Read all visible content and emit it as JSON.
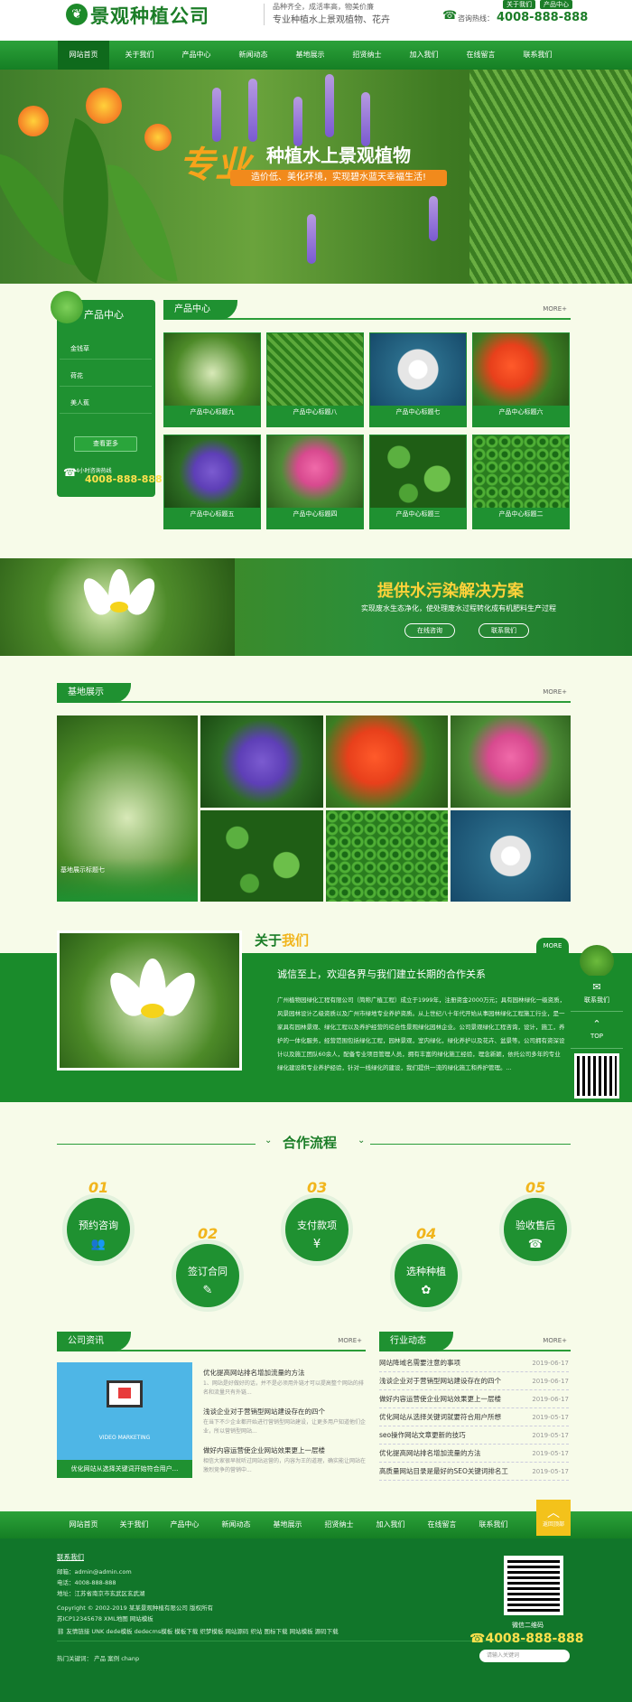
{
  "header": {
    "logo_text": "景观种植公司",
    "slogan_line1": "品种齐全，成活率高，物美价廉",
    "slogan_line2": "专业种植水上景观植物、花卉",
    "top_links": [
      "关于我们",
      "产品中心"
    ],
    "hotline_label": "咨询热线：",
    "hotline": "4008-888-888"
  },
  "nav": {
    "items": [
      "网站首页",
      "关于我们",
      "产品中心",
      "新闻动态",
      "基地展示",
      "招贤纳士",
      "加入我们",
      "在线留言",
      "联系我们"
    ],
    "active_index": 0
  },
  "banner": {
    "title_big": "专业",
    "title_rest": "种植水上景观植物",
    "subtitle": "造价低、美化环境，实现碧水蓝天幸福生活!"
  },
  "products": {
    "sidebar_title": "产品中心",
    "sidebar_items": [
      "金钱草",
      "荷花",
      "美人蕉"
    ],
    "more_button": "查看更多",
    "hotline_label": "24小时咨询热线",
    "hotline": "4008-888-888",
    "section_title": "产品中心",
    "more": "MORE+",
    "items": [
      {
        "title": "产品中心标题九"
      },
      {
        "title": "产品中心标题八"
      },
      {
        "title": "产品中心标题七"
      },
      {
        "title": "产品中心标题六"
      },
      {
        "title": "产品中心标题五"
      },
      {
        "title": "产品中心标题四"
      },
      {
        "title": "产品中心标题三"
      },
      {
        "title": "产品中心标题二"
      }
    ]
  },
  "mid_banner": {
    "title": "提供水污染解决方案",
    "subtitle": "实现废水生态净化，使处理废水过程转化成有机肥料生产过程",
    "buttons": [
      "在线咨询",
      "联系我们"
    ]
  },
  "base": {
    "section_title": "基地展示",
    "more": "MORE+",
    "featured_caption": "基地展示标题七"
  },
  "about": {
    "title_prefix": "关于",
    "title_suffix": "我们",
    "more": "MORE",
    "headline": "诚信至上，欢迎各界与我们建立长期的合作关系",
    "body": "广州植物园绿化工程有限公司（简称广植工程）成立于1999年，注册资金2000万元；具有园林绿化一级资质，风景园林设计乙级资质以及广州市绿地专业养护资质。从上世纪八十年代开始从事园林绿化工程施工行业，是一家具有园林景观、绿化工程以及养护经营的综合性景观绿化园林企业。公司景观绿化工程咨询，设计，施工，养护的一体化服务，经营范围包括绿化工程，园林景观，室内绿化，绿化养护以及花卉、盆景等。公司拥有资深设计以及施工团队60余人，配备专业项目管理人员，拥有丰富的绿化施工经验，理念新颖，依托公司多年的专业绿化建设和专业养护经验，针对一线绿化的建设，我们提供一流的绿化施工和养护管理。..."
  },
  "flow": {
    "title": "合作流程",
    "steps": [
      {
        "num": "01",
        "label": "预约咨询",
        "icon": "people-icon",
        "glyph": "👥"
      },
      {
        "num": "02",
        "label": "签订合同",
        "icon": "edit-icon",
        "glyph": "✎"
      },
      {
        "num": "03",
        "label": "支付款项",
        "icon": "payment-icon",
        "glyph": "¥"
      },
      {
        "num": "04",
        "label": "选种种植",
        "icon": "plant-icon",
        "glyph": "✿"
      },
      {
        "num": "05",
        "label": "验收售后",
        "icon": "headset-icon",
        "glyph": "☎"
      }
    ]
  },
  "news": {
    "section_title": "公司资讯",
    "more": "MORE+",
    "image_caption": "优化网站从选择关键词开始符合用户...",
    "image_banner": "VIDEO MARKETING",
    "items": [
      {
        "title": "优化提高网站排名增加流量的方法",
        "desc": "1、网站是好做好的话，并不是必须用外链才可以提高整个网站的排名和流量只有外链..."
      },
      {
        "title": "浅谈企业对于营销型网站建设存在的四个",
        "desc": "在当下不少企业都开始进行营销型网站建设，让更多用户知道他们企业，所以营销型网站..."
      },
      {
        "title": "做好内容运营使企业网站效果更上一层楼",
        "desc": "相信大家很早就听过网站运营的，内容为王的道理，确实能让网站在激烈竞争的营销中..."
      }
    ]
  },
  "industry": {
    "section_title": "行业动态",
    "more": "MORE+",
    "items": [
      {
        "title": "网站降域名需要注意的事项",
        "date": "2019-06-17"
      },
      {
        "title": "浅谈企业对于营销型网站建设存在的四个",
        "date": "2019-06-17"
      },
      {
        "title": "做好内容运营使企业网站效果更上一层楼",
        "date": "2019-06-17"
      },
      {
        "title": "优化网站从选择关键词就要符合用户所想",
        "date": "2019-05-17"
      },
      {
        "title": "seo操作网站文章更新的技巧",
        "date": "2019-05-17"
      },
      {
        "title": "优化提高网站排名增加流量的方法",
        "date": "2019-05-17"
      },
      {
        "title": "高质量网站目录是最好的SEO关键词排名工",
        "date": "2019-05-17"
      }
    ]
  },
  "footer_nav": {
    "items": [
      "网站首页",
      "关于我们",
      "产品中心",
      "新闻动态",
      "基地展示",
      "招贤纳士",
      "加入我们",
      "在线留言",
      "联系我们"
    ],
    "totop": "返回顶部"
  },
  "footer": {
    "contact_title": "联系我们",
    "email": "邮箱：admin@admin.com",
    "phone": "电话：4008-888-888",
    "address": "地址：江苏省南京市玄武区玄武湖",
    "copyright": "Copyright © 2002-2019 某某景观种植有限公司 版权所有",
    "icp": "苏ICP12345678  XML地图  网站模板",
    "links_label": "友情链接",
    "links": "UNK  dede模板  dedecms模板  模板下载  织梦模板  网站源码  织站  图标下载  网站模板  源码下载",
    "hot_label": "热门关键词：",
    "hot_words": "产品   案例   chanp",
    "qr_label": "微信二维码",
    "tel": "4008-888-888",
    "search_placeholder": "请输入关键词"
  },
  "float_side": {
    "contact": "联系我们",
    "top": "TOP"
  },
  "colors": {
    "primary_green": "#1f9131",
    "dark_green": "#11762a",
    "accent_yellow": "#ffe14d",
    "accent_orange": "#f18a1c",
    "page_bg": "#f7fbe9"
  }
}
